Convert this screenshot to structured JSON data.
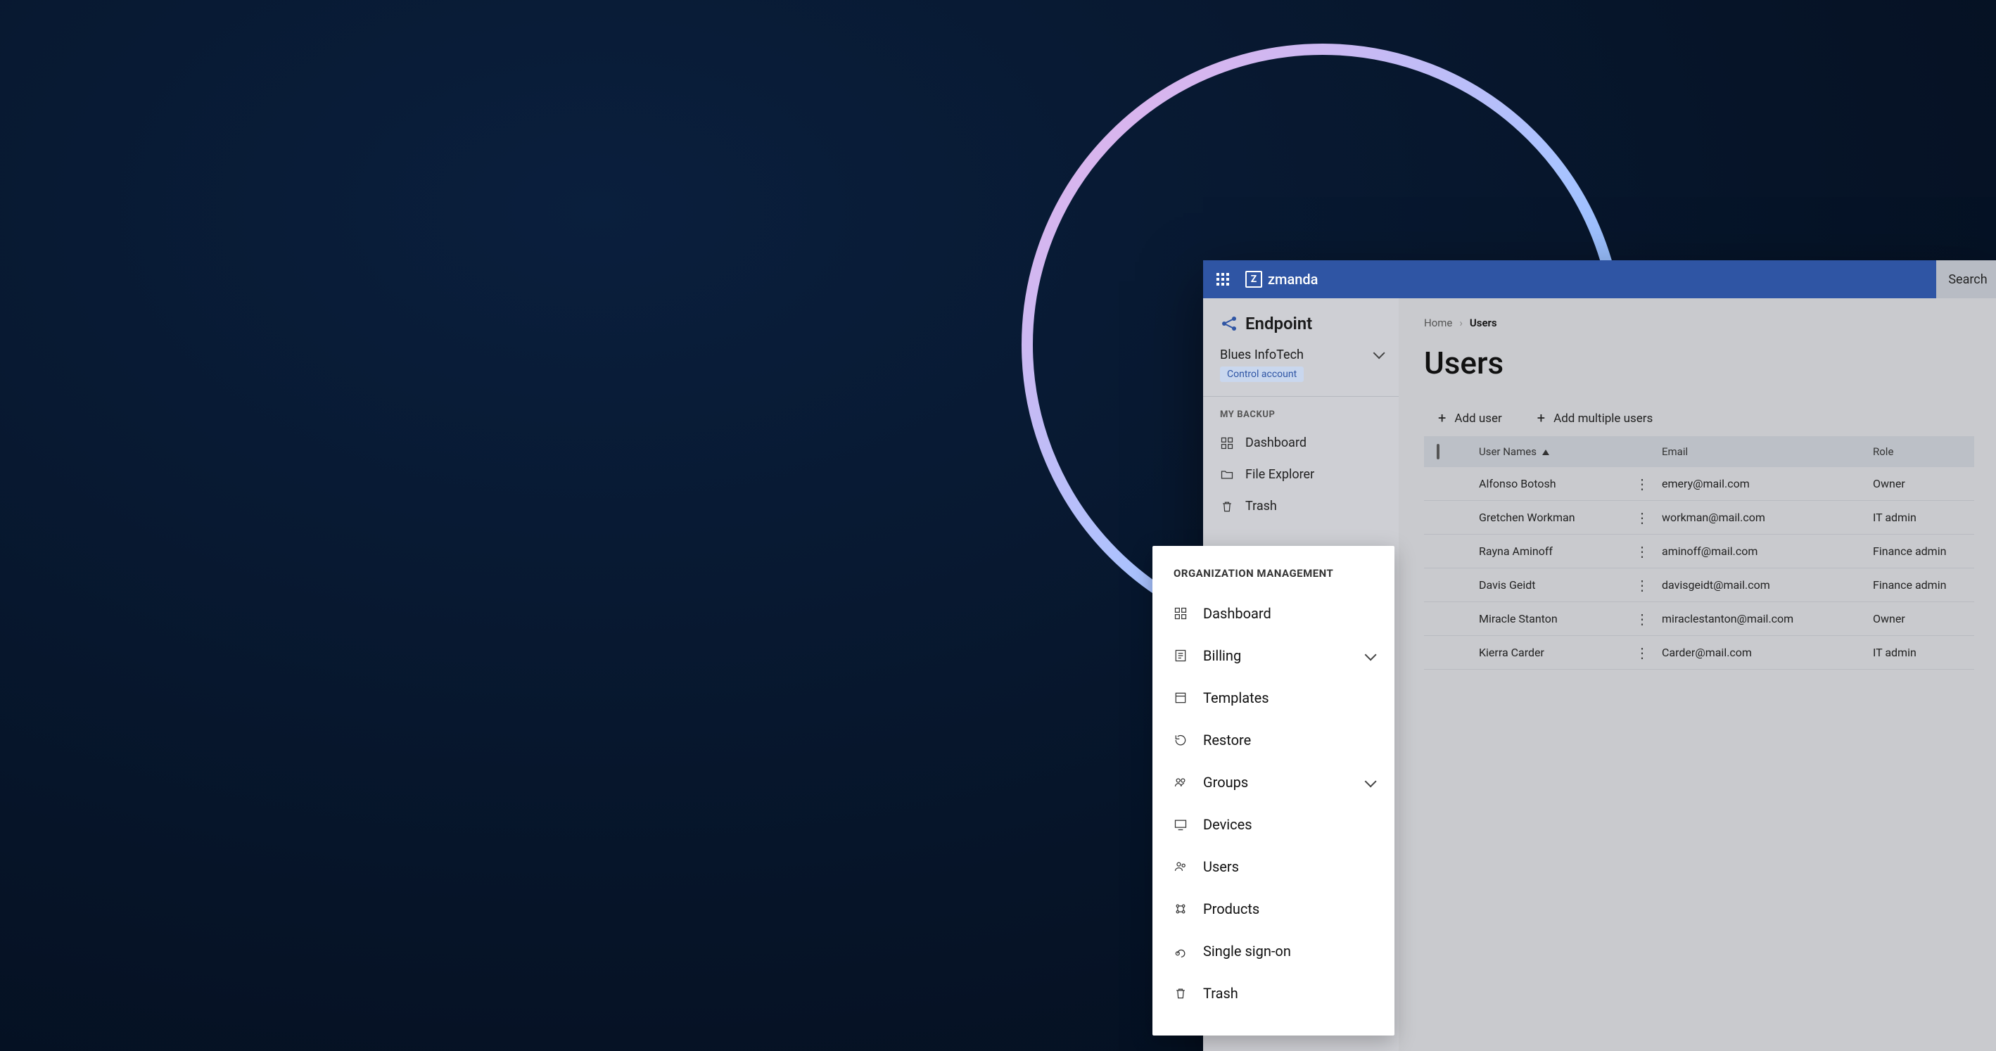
{
  "topbar": {
    "brand": "zmanda",
    "search_label": "Search"
  },
  "sidebar": {
    "product_name": "Endpoint",
    "org_name": "Blues InfoTech",
    "org_tag": "Control account",
    "section_label": "MY BACKUP",
    "items": [
      {
        "label": "Dashboard",
        "icon": "dashboard-icon"
      },
      {
        "label": "File Explorer",
        "icon": "folder-icon"
      },
      {
        "label": "Trash",
        "icon": "trash-icon"
      }
    ]
  },
  "breadcrumb": {
    "root": "Home",
    "current": "Users"
  },
  "page": {
    "title": "Users",
    "actions": [
      {
        "label": "Add user"
      },
      {
        "label": "Add multiple users"
      }
    ],
    "columns": {
      "name": "User Names",
      "email": "Email",
      "role": "Role"
    },
    "rows": [
      {
        "name": "Alfonso Botosh",
        "email": "emery@mail.com",
        "role": "Owner"
      },
      {
        "name": "Gretchen Workman",
        "email": "workman@mail.com",
        "role": "IT admin"
      },
      {
        "name": "Rayna Aminoff",
        "email": "aminoff@mail.com",
        "role": "Finance admin"
      },
      {
        "name": "Davis Geidt",
        "email": "davisgeidt@mail.com",
        "role": "Finance admin"
      },
      {
        "name": "Miracle Stanton",
        "email": "miraclestanton@mail.com",
        "role": "Owner"
      },
      {
        "name": "Kierra Carder",
        "email": "Carder@mail.com",
        "role": "IT admin"
      }
    ]
  },
  "org_panel": {
    "section_label": "ORGANIZATION MANAGEMENT",
    "items": [
      {
        "label": "Dashboard",
        "icon": "dashboard-icon",
        "expandable": false
      },
      {
        "label": "Billing",
        "icon": "billing-icon",
        "expandable": true
      },
      {
        "label": "Templates",
        "icon": "templates-icon",
        "expandable": false
      },
      {
        "label": "Restore",
        "icon": "restore-icon",
        "expandable": false
      },
      {
        "label": "Groups",
        "icon": "groups-icon",
        "expandable": true
      },
      {
        "label": "Devices",
        "icon": "devices-icon",
        "expandable": false
      },
      {
        "label": "Users",
        "icon": "users-icon",
        "expandable": false
      },
      {
        "label": "Products",
        "icon": "products-icon",
        "expandable": false
      },
      {
        "label": "Single sign-on",
        "icon": "sso-icon",
        "expandable": false
      },
      {
        "label": "Trash",
        "icon": "trash-icon",
        "expandable": false
      }
    ]
  }
}
